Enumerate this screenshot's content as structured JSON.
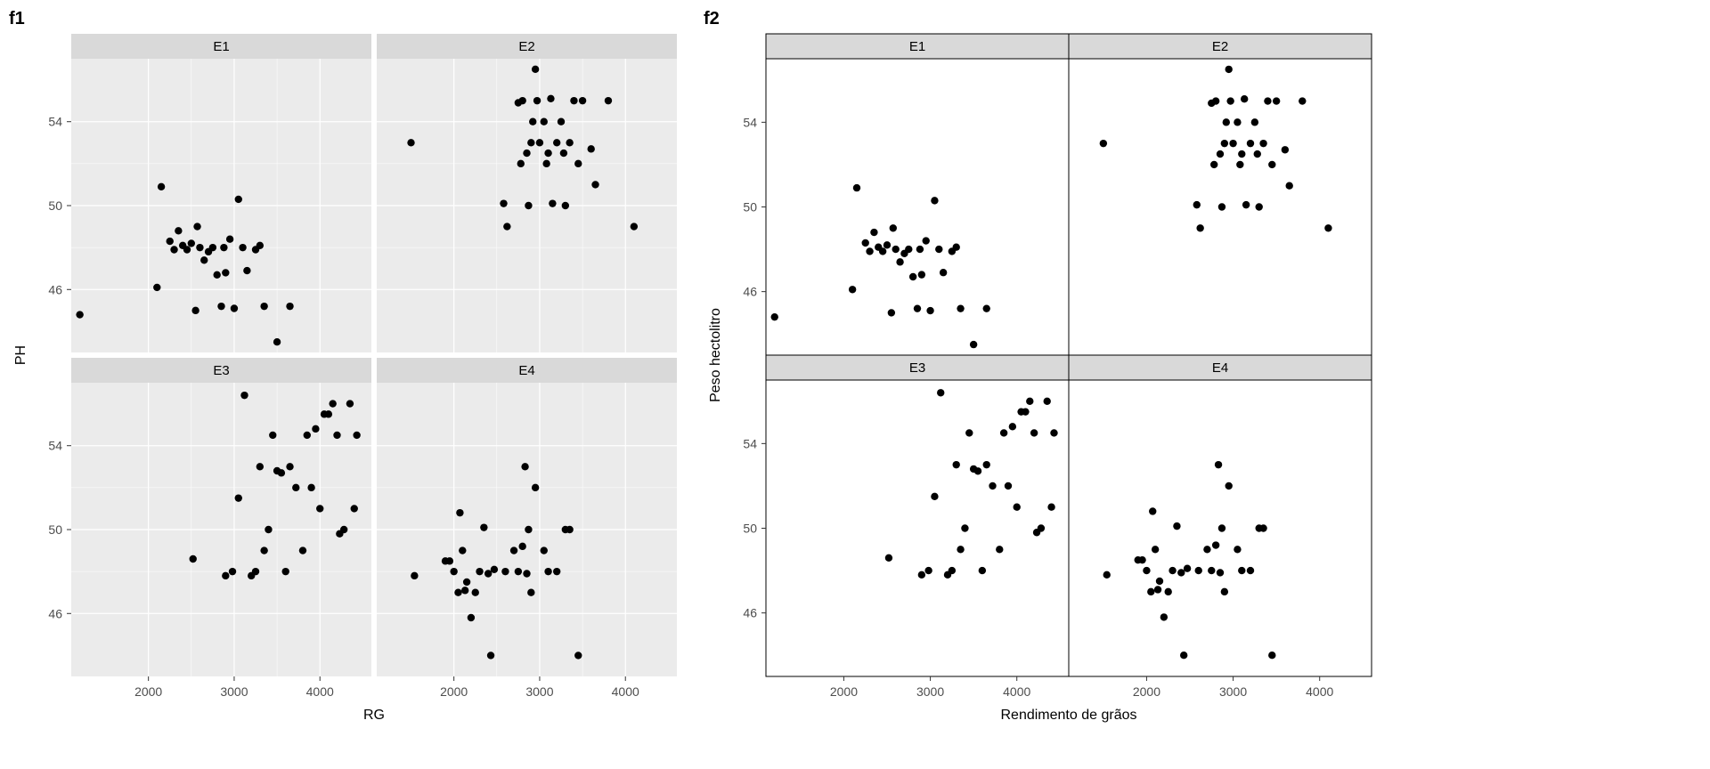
{
  "chart_data": [
    {
      "type": "scatter",
      "id": "f1",
      "title": "f1",
      "xlabel": "RG",
      "ylabel": "PH",
      "theme": "grey",
      "facets": [
        "E1",
        "E2",
        "E3",
        "E4"
      ],
      "xlim": [
        1100,
        4600
      ],
      "ylim": [
        43,
        57
      ],
      "xticks": [
        2000,
        3000,
        4000
      ],
      "yticks": [
        46,
        50,
        54
      ],
      "series": [
        {
          "facet": "E1",
          "points": [
            [
              1200,
              44.8
            ],
            [
              2100,
              46.1
            ],
            [
              2150,
              50.9
            ],
            [
              2250,
              48.3
            ],
            [
              2300,
              47.9
            ],
            [
              2350,
              48.8
            ],
            [
              2400,
              48.1
            ],
            [
              2450,
              47.9
            ],
            [
              2500,
              48.2
            ],
            [
              2550,
              45.0
            ],
            [
              2570,
              49.0
            ],
            [
              2600,
              48.0
            ],
            [
              2650,
              47.4
            ],
            [
              2700,
              47.8
            ],
            [
              2750,
              48.0
            ],
            [
              2800,
              46.7
            ],
            [
              2850,
              45.2
            ],
            [
              2880,
              48.0
            ],
            [
              2900,
              46.8
            ],
            [
              2950,
              48.4
            ],
            [
              3000,
              45.1
            ],
            [
              3050,
              50.3
            ],
            [
              3100,
              48.0
            ],
            [
              3150,
              46.9
            ],
            [
              3250,
              47.9
            ],
            [
              3300,
              48.1
            ],
            [
              3350,
              45.2
            ],
            [
              3500,
              43.5
            ],
            [
              3650,
              45.2
            ]
          ]
        },
        {
          "facet": "E2",
          "points": [
            [
              1500,
              53.0
            ],
            [
              2580,
              50.1
            ],
            [
              2620,
              49.0
            ],
            [
              2750,
              54.9
            ],
            [
              2780,
              52.0
            ],
            [
              2800,
              55.0
            ],
            [
              2850,
              52.5
            ],
            [
              2870,
              50.0
            ],
            [
              2900,
              53.0
            ],
            [
              2920,
              54.0
            ],
            [
              2950,
              56.5
            ],
            [
              2970,
              55.0
            ],
            [
              3000,
              53.0
            ],
            [
              3050,
              54.0
            ],
            [
              3080,
              52.0
            ],
            [
              3100,
              52.5
            ],
            [
              3130,
              55.1
            ],
            [
              3150,
              50.1
            ],
            [
              3200,
              53.0
            ],
            [
              3250,
              54.0
            ],
            [
              3280,
              52.5
            ],
            [
              3300,
              50.0
            ],
            [
              3350,
              53.0
            ],
            [
              3400,
              55.0
            ],
            [
              3450,
              52.0
            ],
            [
              3500,
              55.0
            ],
            [
              3600,
              52.7
            ],
            [
              3650,
              51.0
            ],
            [
              3800,
              55.0
            ],
            [
              4100,
              49.0
            ]
          ]
        },
        {
          "facet": "E3",
          "points": [
            [
              2520,
              48.6
            ],
            [
              2900,
              47.8
            ],
            [
              2980,
              48.0
            ],
            [
              3050,
              51.5
            ],
            [
              3120,
              56.4
            ],
            [
              3200,
              47.8
            ],
            [
              3250,
              48.0
            ],
            [
              3300,
              53.0
            ],
            [
              3350,
              49.0
            ],
            [
              3400,
              50.0
            ],
            [
              3450,
              54.5
            ],
            [
              3500,
              52.8
            ],
            [
              3550,
              52.7
            ],
            [
              3600,
              48.0
            ],
            [
              3650,
              53.0
            ],
            [
              3720,
              52.0
            ],
            [
              3800,
              49.0
            ],
            [
              3850,
              54.5
            ],
            [
              3900,
              52.0
            ],
            [
              3950,
              54.8
            ],
            [
              4000,
              51.0
            ],
            [
              4050,
              55.5
            ],
            [
              4100,
              55.5
            ],
            [
              4150,
              56.0
            ],
            [
              4200,
              54.5
            ],
            [
              4230,
              49.8
            ],
            [
              4280,
              50.0
            ],
            [
              4350,
              56.0
            ],
            [
              4400,
              51.0
            ],
            [
              4430,
              54.5
            ]
          ]
        },
        {
          "facet": "E4",
          "points": [
            [
              1540,
              47.8
            ],
            [
              1900,
              48.5
            ],
            [
              1950,
              48.5
            ],
            [
              2000,
              48.0
            ],
            [
              2050,
              47.0
            ],
            [
              2070,
              50.8
            ],
            [
              2100,
              49.0
            ],
            [
              2130,
              47.1
            ],
            [
              2150,
              47.5
            ],
            [
              2200,
              45.8
            ],
            [
              2250,
              47.0
            ],
            [
              2300,
              48.0
            ],
            [
              2350,
              50.1
            ],
            [
              2400,
              47.9
            ],
            [
              2430,
              44.0
            ],
            [
              2470,
              48.1
            ],
            [
              2600,
              48.0
            ],
            [
              2700,
              49.0
            ],
            [
              2750,
              48.0
            ],
            [
              2800,
              49.2
            ],
            [
              2830,
              53.0
            ],
            [
              2850,
              47.9
            ],
            [
              2870,
              50.0
            ],
            [
              2900,
              47.0
            ],
            [
              2950,
              52.0
            ],
            [
              3050,
              49.0
            ],
            [
              3100,
              48.0
            ],
            [
              3200,
              48.0
            ],
            [
              3300,
              50.0
            ],
            [
              3350,
              50.0
            ],
            [
              3450,
              44.0
            ]
          ]
        }
      ]
    },
    {
      "type": "scatter",
      "id": "f2",
      "title": "f2",
      "xlabel": "Rendimento de grãos",
      "ylabel": "Peso hectolitro",
      "theme": "bw",
      "facets": [
        "E1",
        "E2",
        "E3",
        "E4"
      ],
      "xlim": [
        1100,
        4600
      ],
      "ylim": [
        43,
        57
      ],
      "xticks": [
        2000,
        3000,
        4000
      ],
      "yticks": [
        46,
        50,
        54
      ],
      "series": [
        {
          "facet": "E1",
          "points": [
            [
              1200,
              44.8
            ],
            [
              2100,
              46.1
            ],
            [
              2150,
              50.9
            ],
            [
              2250,
              48.3
            ],
            [
              2300,
              47.9
            ],
            [
              2350,
              48.8
            ],
            [
              2400,
              48.1
            ],
            [
              2450,
              47.9
            ],
            [
              2500,
              48.2
            ],
            [
              2550,
              45.0
            ],
            [
              2570,
              49.0
            ],
            [
              2600,
              48.0
            ],
            [
              2650,
              47.4
            ],
            [
              2700,
              47.8
            ],
            [
              2750,
              48.0
            ],
            [
              2800,
              46.7
            ],
            [
              2850,
              45.2
            ],
            [
              2880,
              48.0
            ],
            [
              2900,
              46.8
            ],
            [
              2950,
              48.4
            ],
            [
              3000,
              45.1
            ],
            [
              3050,
              50.3
            ],
            [
              3100,
              48.0
            ],
            [
              3150,
              46.9
            ],
            [
              3250,
              47.9
            ],
            [
              3300,
              48.1
            ],
            [
              3350,
              45.2
            ],
            [
              3500,
              43.5
            ],
            [
              3650,
              45.2
            ]
          ]
        },
        {
          "facet": "E2",
          "points": [
            [
              1500,
              53.0
            ],
            [
              2580,
              50.1
            ],
            [
              2620,
              49.0
            ],
            [
              2750,
              54.9
            ],
            [
              2780,
              52.0
            ],
            [
              2800,
              55.0
            ],
            [
              2850,
              52.5
            ],
            [
              2870,
              50.0
            ],
            [
              2900,
              53.0
            ],
            [
              2920,
              54.0
            ],
            [
              2950,
              56.5
            ],
            [
              2970,
              55.0
            ],
            [
              3000,
              53.0
            ],
            [
              3050,
              54.0
            ],
            [
              3080,
              52.0
            ],
            [
              3100,
              52.5
            ],
            [
              3130,
              55.1
            ],
            [
              3150,
              50.1
            ],
            [
              3200,
              53.0
            ],
            [
              3250,
              54.0
            ],
            [
              3280,
              52.5
            ],
            [
              3300,
              50.0
            ],
            [
              3350,
              53.0
            ],
            [
              3400,
              55.0
            ],
            [
              3450,
              52.0
            ],
            [
              3500,
              55.0
            ],
            [
              3600,
              52.7
            ],
            [
              3650,
              51.0
            ],
            [
              3800,
              55.0
            ],
            [
              4100,
              49.0
            ]
          ]
        },
        {
          "facet": "E3",
          "points": [
            [
              2520,
              48.6
            ],
            [
              2900,
              47.8
            ],
            [
              2980,
              48.0
            ],
            [
              3050,
              51.5
            ],
            [
              3120,
              56.4
            ],
            [
              3200,
              47.8
            ],
            [
              3250,
              48.0
            ],
            [
              3300,
              53.0
            ],
            [
              3350,
              49.0
            ],
            [
              3400,
              50.0
            ],
            [
              3450,
              54.5
            ],
            [
              3500,
              52.8
            ],
            [
              3550,
              52.7
            ],
            [
              3600,
              48.0
            ],
            [
              3650,
              53.0
            ],
            [
              3720,
              52.0
            ],
            [
              3800,
              49.0
            ],
            [
              3850,
              54.5
            ],
            [
              3900,
              52.0
            ],
            [
              3950,
              54.8
            ],
            [
              4000,
              51.0
            ],
            [
              4050,
              55.5
            ],
            [
              4100,
              55.5
            ],
            [
              4150,
              56.0
            ],
            [
              4200,
              54.5
            ],
            [
              4230,
              49.8
            ],
            [
              4280,
              50.0
            ],
            [
              4350,
              56.0
            ],
            [
              4400,
              51.0
            ],
            [
              4430,
              54.5
            ]
          ]
        },
        {
          "facet": "E4",
          "points": [
            [
              1540,
              47.8
            ],
            [
              1900,
              48.5
            ],
            [
              1950,
              48.5
            ],
            [
              2000,
              48.0
            ],
            [
              2050,
              47.0
            ],
            [
              2070,
              50.8
            ],
            [
              2100,
              49.0
            ],
            [
              2130,
              47.1
            ],
            [
              2150,
              47.5
            ],
            [
              2200,
              45.8
            ],
            [
              2250,
              47.0
            ],
            [
              2300,
              48.0
            ],
            [
              2350,
              50.1
            ],
            [
              2400,
              47.9
            ],
            [
              2430,
              44.0
            ],
            [
              2470,
              48.1
            ],
            [
              2600,
              48.0
            ],
            [
              2700,
              49.0
            ],
            [
              2750,
              48.0
            ],
            [
              2800,
              49.2
            ],
            [
              2830,
              53.0
            ],
            [
              2850,
              47.9
            ],
            [
              2870,
              50.0
            ],
            [
              2900,
              47.0
            ],
            [
              2950,
              52.0
            ],
            [
              3050,
              49.0
            ],
            [
              3100,
              48.0
            ],
            [
              3200,
              48.0
            ],
            [
              3300,
              50.0
            ],
            [
              3350,
              50.0
            ],
            [
              3450,
              44.0
            ]
          ]
        }
      ]
    }
  ]
}
